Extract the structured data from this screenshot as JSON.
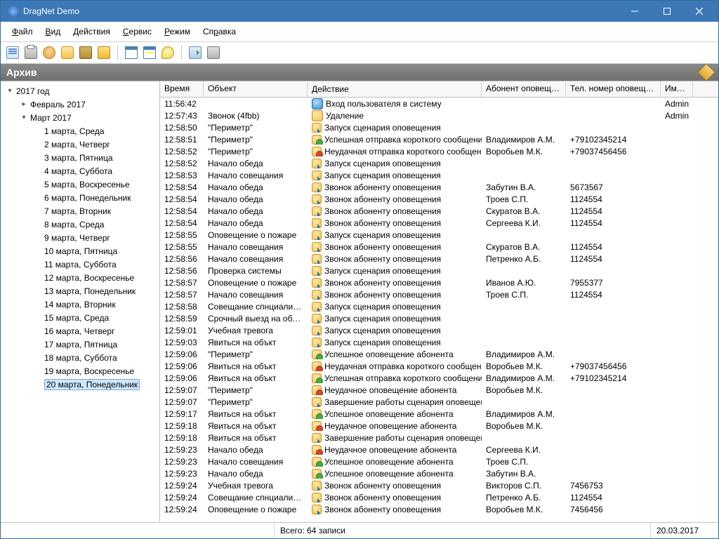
{
  "window": {
    "title": "DragNet Demo"
  },
  "menu": {
    "items": [
      "Файл",
      "Вид",
      "Действия",
      "Сервис",
      "Режим",
      "Справка"
    ]
  },
  "header": {
    "title": "Архив"
  },
  "tree": {
    "root": "2017 год",
    "months": [
      {
        "label": "Февраль 2017",
        "expanded": false
      },
      {
        "label": "Март 2017",
        "expanded": true,
        "days": [
          "1 марта, Среда",
          "2 марта, Четверг",
          "3 марта, Пятница",
          "4 марта, Суббота",
          "5 марта, Воскресенье",
          "6 марта, Понедельник",
          "7 марта, Вторник",
          "8 марта, Среда",
          "9 марта, Четверг",
          "10 марта, Пятница",
          "11 марта, Суббота",
          "12 марта, Воскресенье",
          "13 марта, Понедельник",
          "14 марта, Вторник",
          "15 марта, Среда",
          "16 марта, Четверг",
          "17 марта, Пятница",
          "18 марта, Суббота",
          "19 марта, Воскресенье",
          "20 марта, Понедельник"
        ],
        "selected_index": 19
      }
    ]
  },
  "columns": [
    "Время",
    "Объект",
    "Действие",
    "Абонент оповещения",
    "Тел. номер оповещения",
    "Имя ..."
  ],
  "rows": [
    {
      "time": "11:56:42",
      "obj": "",
      "icon": "blue",
      "act": "Вход пользователя в систему",
      "sub": "",
      "phone": "",
      "name": "Admin"
    },
    {
      "time": "12:57:43",
      "obj": "Звонок (4fbb)",
      "icon": "yellow",
      "act": "Удаление",
      "sub": "",
      "phone": "",
      "name": "Admin"
    },
    {
      "time": "12:58:50",
      "obj": "\"Периметр\"",
      "icon": "arrow",
      "act": "Запуск сценария оповещения",
      "sub": "",
      "phone": "",
      "name": ""
    },
    {
      "time": "12:58:51",
      "obj": "\"Периметр\"",
      "icon": "green",
      "act": "Успешная отправка короткого сообщения",
      "sub": "Владимиров А.М.",
      "phone": "+79102345214",
      "name": ""
    },
    {
      "time": "12:58:52",
      "obj": "\"Периметр\"",
      "icon": "red",
      "act": "Неудачная отправка короткого сообщения",
      "sub": "Воробьев М.К.",
      "phone": "+79037456456",
      "name": ""
    },
    {
      "time": "12:58:52",
      "obj": "Начало обеда",
      "icon": "arrow",
      "act": "Запуск сценария оповещения",
      "sub": "",
      "phone": "",
      "name": ""
    },
    {
      "time": "12:58:53",
      "obj": "Начало совещания",
      "icon": "arrow",
      "act": "Запуск сценария оповещения",
      "sub": "",
      "phone": "",
      "name": ""
    },
    {
      "time": "12:58:54",
      "obj": "Начало обеда",
      "icon": "arrow",
      "act": "Звонок абоненту оповещения",
      "sub": "Забутин В.А.",
      "phone": "5673567",
      "name": ""
    },
    {
      "time": "12:58:54",
      "obj": "Начало обеда",
      "icon": "arrow",
      "act": "Звонок абоненту оповещения",
      "sub": "Троев С.П.",
      "phone": "1124554",
      "name": ""
    },
    {
      "time": "12:58:54",
      "obj": "Начало обеда",
      "icon": "arrow",
      "act": "Звонок абоненту оповещения",
      "sub": "Скуратов В.А.",
      "phone": "1124554",
      "name": ""
    },
    {
      "time": "12:58:54",
      "obj": "Начало обеда",
      "icon": "arrow",
      "act": "Звонок абоненту оповещения",
      "sub": "Сергеева К.И.",
      "phone": "1124554",
      "name": ""
    },
    {
      "time": "12:58:55",
      "obj": "Оповещение о пожаре",
      "icon": "arrow",
      "act": "Запуск сценария оповещения",
      "sub": "",
      "phone": "",
      "name": ""
    },
    {
      "time": "12:58:55",
      "obj": "Начало совещания",
      "icon": "arrow",
      "act": "Звонок абоненту оповещения",
      "sub": "Скуратов В.А.",
      "phone": "1124554",
      "name": ""
    },
    {
      "time": "12:58:56",
      "obj": "Начало совещания",
      "icon": "arrow",
      "act": "Звонок абоненту оповещения",
      "sub": "Петренко А.Б.",
      "phone": "1124554",
      "name": ""
    },
    {
      "time": "12:58:56",
      "obj": "Проверка системы",
      "icon": "arrow",
      "act": "Запуск сценария оповещения",
      "sub": "",
      "phone": "",
      "name": ""
    },
    {
      "time": "12:58:57",
      "obj": "Оповещение о пожаре",
      "icon": "arrow",
      "act": "Звонок абоненту оповещения",
      "sub": "Иванов А.Ю.",
      "phone": "7955377",
      "name": ""
    },
    {
      "time": "12:58:57",
      "obj": "Начало совещания",
      "icon": "arrow",
      "act": "Звонок абоненту оповещения",
      "sub": "Троев С.П.",
      "phone": "1124554",
      "name": ""
    },
    {
      "time": "12:58:58",
      "obj": "Совещание спнциалистов",
      "icon": "arrow",
      "act": "Запуск сценария оповещения",
      "sub": "",
      "phone": "",
      "name": ""
    },
    {
      "time": "12:58:59",
      "obj": "Срочный выезд на объект",
      "icon": "arrow",
      "act": "Запуск сценария оповещения",
      "sub": "",
      "phone": "",
      "name": ""
    },
    {
      "time": "12:59:01",
      "obj": "Учебная тревога",
      "icon": "arrow",
      "act": "Запуск сценария оповещения",
      "sub": "",
      "phone": "",
      "name": ""
    },
    {
      "time": "12:59:03",
      "obj": "Явиться на объкт",
      "icon": "arrow",
      "act": "Запуск сценария оповещения",
      "sub": "",
      "phone": "",
      "name": ""
    },
    {
      "time": "12:59:06",
      "obj": "\"Периметр\"",
      "icon": "green",
      "act": "Успешное оповещение абонента",
      "sub": "Владимиров А.М.",
      "phone": "",
      "name": ""
    },
    {
      "time": "12:59:06",
      "obj": "Явиться на объкт",
      "icon": "red",
      "act": "Неудачная отправка короткого сообщения",
      "sub": "Воробьев М.К.",
      "phone": "+79037456456",
      "name": ""
    },
    {
      "time": "12:59:06",
      "obj": "Явиться на объкт",
      "icon": "green",
      "act": "Успешная отправка короткого сообщения",
      "sub": "Владимиров А.М.",
      "phone": "+79102345214",
      "name": ""
    },
    {
      "time": "12:59:07",
      "obj": "\"Периметр\"",
      "icon": "red",
      "act": "Неудачное оповещение абонента",
      "sub": "Воробьев М.К.",
      "phone": "",
      "name": ""
    },
    {
      "time": "12:59:07",
      "obj": "\"Периметр\"",
      "icon": "arrow",
      "act": "Завершение работы сценария оповещения",
      "sub": "",
      "phone": "",
      "name": ""
    },
    {
      "time": "12:59:17",
      "obj": "Явиться на объкт",
      "icon": "green",
      "act": "Успешное оповещение абонента",
      "sub": "Владимиров А.М.",
      "phone": "",
      "name": ""
    },
    {
      "time": "12:59:18",
      "obj": "Явиться на объкт",
      "icon": "red",
      "act": "Неудачное оповещение абонента",
      "sub": "Воробьев М.К.",
      "phone": "",
      "name": ""
    },
    {
      "time": "12:59:18",
      "obj": "Явиться на объкт",
      "icon": "arrow",
      "act": "Завершение работы сценария оповещения",
      "sub": "",
      "phone": "",
      "name": ""
    },
    {
      "time": "12:59:23",
      "obj": "Начало обеда",
      "icon": "red",
      "act": "Неудачное оповещение абонента",
      "sub": "Сергеева К.И.",
      "phone": "",
      "name": ""
    },
    {
      "time": "12:59:23",
      "obj": "Начало совещания",
      "icon": "green",
      "act": "Успешное оповещение абонента",
      "sub": "Троев С.П.",
      "phone": "",
      "name": ""
    },
    {
      "time": "12:59:23",
      "obj": "Начало обеда",
      "icon": "green",
      "act": "Успешное оповещение абонента",
      "sub": "Забутин В.А.",
      "phone": "",
      "name": ""
    },
    {
      "time": "12:59:24",
      "obj": "Учебная тревога",
      "icon": "arrow",
      "act": "Звонок абоненту оповещения",
      "sub": "Викторов С.П.",
      "phone": "7456753",
      "name": ""
    },
    {
      "time": "12:59:24",
      "obj": "Совещание спнциалистов",
      "icon": "arrow",
      "act": "Звонок абоненту оповещения",
      "sub": "Петренко А.Б.",
      "phone": "1124554",
      "name": ""
    },
    {
      "time": "12:59:24",
      "obj": "Оповещение о пожаре",
      "icon": "arrow",
      "act": "Звонок абоненту оповещения",
      "sub": "Воробьев М.К.",
      "phone": "7456456",
      "name": ""
    }
  ],
  "status": {
    "total_label": "Всего: 64 записи",
    "date": "20.03.2017"
  }
}
